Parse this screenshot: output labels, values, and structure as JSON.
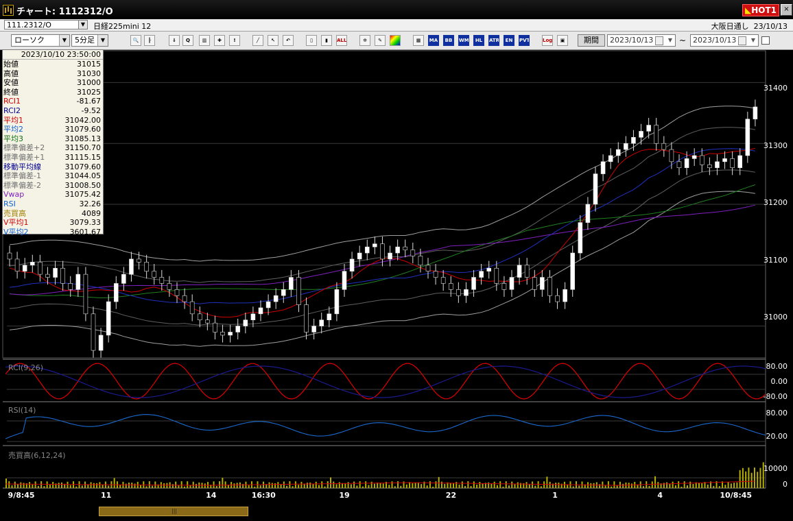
{
  "window": {
    "title": "チャート: 1112312/O",
    "hot_label": "HOT",
    "hot_num": "1"
  },
  "infobar": {
    "symbol_code": "111.2312/O",
    "symbol_name": "日経225mini 12",
    "exchange": "大阪日通し",
    "date": "23/10/13"
  },
  "toolbar": {
    "chart_type": "ローソク",
    "interval": "5分足",
    "period_label": "期間",
    "date_from": "2023/10/13",
    "date_to": "2023/10/13",
    "separator": "~",
    "button_texts": {
      "ma": "MA",
      "bb": "BB",
      "wma": "WMA",
      "hl": "HL",
      "atr": "ATR",
      "env": "EN",
      "pvt": "PVT",
      "all": "ALL",
      "log": "Log"
    }
  },
  "info_panel": {
    "datetime": "2023/10/10  23:50:00",
    "rows": [
      {
        "label": "始値",
        "value": "31015",
        "color": "#000000"
      },
      {
        "label": "高値",
        "value": "31030",
        "color": "#000000"
      },
      {
        "label": "安値",
        "value": "31000",
        "color": "#000000"
      },
      {
        "label": "終値",
        "value": "31025",
        "color": "#000000"
      },
      {
        "label": "RCI1",
        "value": "-81.67",
        "color": "#d00000"
      },
      {
        "label": "RCI2",
        "value": "-9.52",
        "color": "#000090"
      },
      {
        "label": "平均1",
        "value": "31042.00",
        "color": "#d00000"
      },
      {
        "label": "平均2",
        "value": "31079.60",
        "color": "#1060d0"
      },
      {
        "label": "平均3",
        "value": "31085.13",
        "color": "#107010"
      },
      {
        "label": "標準偏差+2",
        "value": "31150.70",
        "color": "#707070"
      },
      {
        "label": "標準偏差+1",
        "value": "31115.15",
        "color": "#707070"
      },
      {
        "label": "移動平均線",
        "value": "31079.60",
        "color": "#000090"
      },
      {
        "label": "標準偏差-1",
        "value": "31044.05",
        "color": "#707070"
      },
      {
        "label": "標準偏差-2",
        "value": "31008.50",
        "color": "#707070"
      },
      {
        "label": "Vwap",
        "value": "31075.42",
        "color": "#8020c0"
      },
      {
        "label": "RSI",
        "value": "32.26",
        "color": "#1060d0"
      },
      {
        "label": "売買高",
        "value": "4089",
        "color": "#a08000"
      },
      {
        "label": "V平均1",
        "value": "3079.33",
        "color": "#d00000"
      },
      {
        "label": "V平均2",
        "value": "3601.67",
        "color": "#1060d0"
      }
    ]
  },
  "price_axis": [
    "31400",
    "31300",
    "31200",
    "31100",
    "31000"
  ],
  "rci_panel": {
    "label": "RCI(9,26)",
    "ticks": [
      "80.00",
      "0.00",
      "-80.00"
    ]
  },
  "rsi_panel": {
    "label": "RSI(14)",
    "ticks": [
      "80.00",
      "20.00"
    ]
  },
  "volume_panel": {
    "label": "売買高(6,12,24)",
    "ticks": [
      "10000",
      "0"
    ]
  },
  "time_axis": [
    {
      "label": "9/8:45",
      "pos": 0.005
    },
    {
      "label": "11",
      "pos": 0.127
    },
    {
      "label": "14",
      "pos": 0.265
    },
    {
      "label": "16:30",
      "pos": 0.325
    },
    {
      "label": "19",
      "pos": 0.44
    },
    {
      "label": "22",
      "pos": 0.58
    },
    {
      "label": "1",
      "pos": 0.72
    },
    {
      "label": "4",
      "pos": 0.858
    },
    {
      "label": "10/8:45",
      "pos": 0.94
    }
  ],
  "chart_data": {
    "type": "candlestick",
    "interval": "5分足",
    "ylim": [
      30950,
      31450
    ],
    "close": [
      31110,
      31090,
      31100,
      31105,
      31085,
      31080,
      31095,
      31070,
      31060,
      31085,
      31020,
      30960,
      30985,
      31040,
      31070,
      31085,
      31110,
      31105,
      31090,
      31080,
      31070,
      31060,
      31050,
      31040,
      31020,
      31010,
      31005,
      30990,
      30985,
      30990,
      31000,
      31010,
      31020,
      31030,
      31040,
      31050,
      31060,
      31080,
      31035,
      30990,
      31000,
      31010,
      31020,
      31060,
      31090,
      31110,
      31120,
      31130,
      31135,
      31110,
      31120,
      31130,
      31125,
      31115,
      31100,
      31090,
      31080,
      31070,
      31060,
      31050,
      31060,
      31080,
      31090,
      31095,
      31070,
      31060,
      31080,
      31100,
      31080,
      31060,
      31080,
      31050,
      31040,
      31060,
      31120,
      31170,
      31200,
      31250,
      31270,
      31280,
      31290,
      31300,
      31310,
      31320,
      31330,
      31300,
      31290,
      31270,
      31260,
      31275,
      31280,
      31265,
      31260,
      31270,
      31275,
      31260,
      31280,
      31340,
      31360
    ],
    "ma_short": "赤",
    "indicators": [
      "RCI(9,26)",
      "RSI(14)",
      "売買高(6,12,24)",
      "ボリンジャーバンド",
      "VWAP"
    ]
  },
  "colors": {
    "background": "#000000",
    "candle_up": "#ffffff",
    "candle_down": "#000000",
    "ma1": "#d00000",
    "ma2": "#2030c0",
    "ma3": "#208020",
    "vwap": "#8020c0",
    "band": "#a0a0a0",
    "rci1": "#e00000",
    "rci2": "#1a1a90",
    "rsi": "#1a6ad0",
    "volume": "#b8b000"
  }
}
